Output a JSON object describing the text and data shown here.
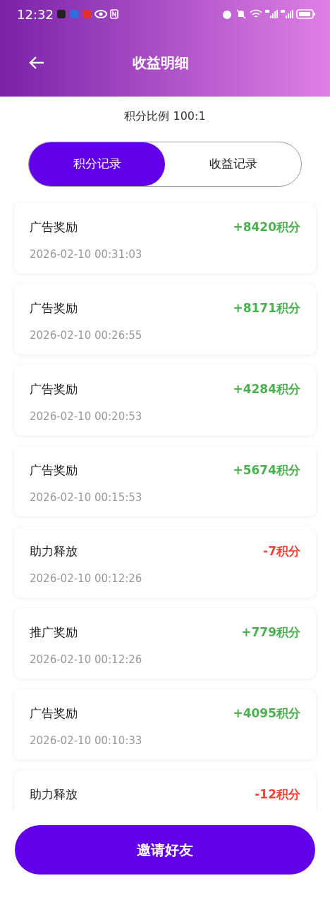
{
  "status_bar": {
    "time": "12:32"
  },
  "header": {
    "title": "收益明细"
  },
  "ratio": "积分比例 100:1",
  "tabs": [
    {
      "label": "积分记录",
      "selected": true
    },
    {
      "label": "收益记录",
      "selected": false
    }
  ],
  "records": [
    {
      "title": "广告奖励",
      "time": "2026-02-10 00:31:03",
      "amount": "+8420积分",
      "kind": "gain"
    },
    {
      "title": "广告奖励",
      "time": "2026-02-10 00:26:55",
      "amount": "+8171积分",
      "kind": "gain"
    },
    {
      "title": "广告奖励",
      "time": "2026-02-10 00:20:53",
      "amount": "+4284积分",
      "kind": "gain"
    },
    {
      "title": "广告奖励",
      "time": "2026-02-10 00:15:53",
      "amount": "+5674积分",
      "kind": "gain"
    },
    {
      "title": "助力释放",
      "time": "2026-02-10 00:12:26",
      "amount": "-7积分",
      "kind": "loss"
    },
    {
      "title": "推广奖励",
      "time": "2026-02-10 00:12:26",
      "amount": "+779积分",
      "kind": "gain"
    },
    {
      "title": "广告奖励",
      "time": "2026-02-10 00:10:33",
      "amount": "+4095积分",
      "kind": "gain"
    },
    {
      "title": "助力释放",
      "amount": "-12积分",
      "kind": "loss"
    }
  ],
  "invite_button": "邀请好友"
}
